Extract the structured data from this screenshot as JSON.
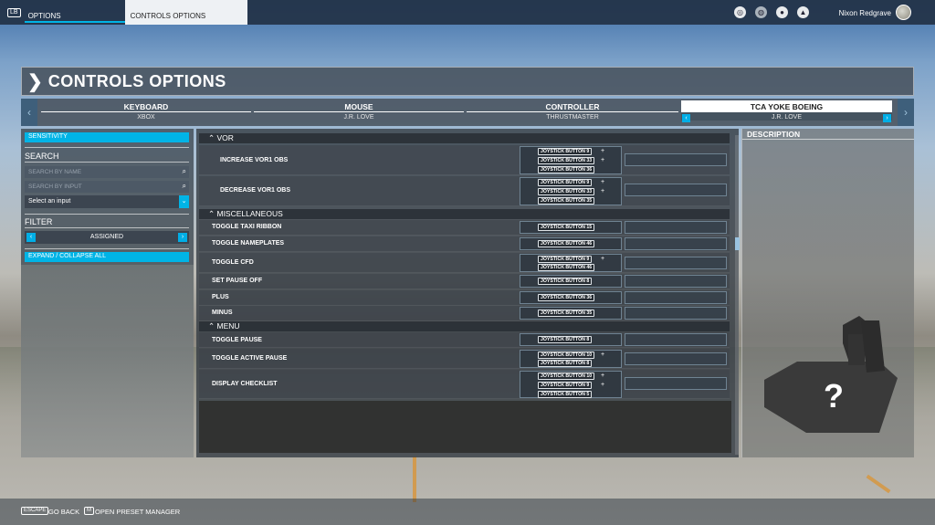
{
  "topbar": {
    "lb_key": "LB",
    "tab_options": "OPTIONS",
    "tab_controls_options": "CONTROLS OPTIONS",
    "username": "Nixon Redgrave"
  },
  "header": {
    "title": "CONTROLS OPTIONS"
  },
  "device_tabs": [
    {
      "name": "KEYBOARD",
      "profile": "XBOX"
    },
    {
      "name": "MOUSE",
      "profile": "J.R. LOVE"
    },
    {
      "name": "CONTROLLER",
      "profile": "THRUSTMASTER"
    },
    {
      "name": "TCA YOKE BOEING",
      "profile": "J.R. LOVE"
    }
  ],
  "sidebar": {
    "sensitivity": "SENSITIVITY",
    "search_label": "SEARCH",
    "search_by_name": "SEARCH BY NAME",
    "search_by_input": "SEARCH BY INPUT",
    "select_input": "Select an input",
    "filter_label": "FILTER",
    "filter_value": "ASSIGNED",
    "expand_collapse": "EXPAND / COLLAPSE ALL"
  },
  "list": {
    "categories": [
      "VOR",
      "MISCELLANEOUS",
      "MENU"
    ],
    "rows": [
      {
        "label": "INCREASE VOR1 OBS",
        "buttons": [
          "JOYSTICK BUTTON 9",
          "JOYSTICK BUTTON 33",
          "JOYSTICK BUTTON 36"
        ]
      },
      {
        "label": "DECREASE VOR1 OBS",
        "buttons": [
          "JOYSTICK BUTTON 9",
          "JOYSTICK BUTTON 33",
          "JOYSTICK BUTTON 35"
        ]
      },
      {
        "label": "TOGGLE TAXI RIBBON",
        "buttons": [
          "JOYSTICK BUTTON 15"
        ]
      },
      {
        "label": "TOGGLE NAMEPLATES",
        "buttons": [
          "JOYSTICK BUTTON 46"
        ]
      },
      {
        "label": "TOGGLE CFD",
        "buttons": [
          "JOYSTICK BUTTON 9",
          "JOYSTICK BUTTON 46"
        ]
      },
      {
        "label": "SET PAUSE OFF",
        "buttons": [
          "JOYSTICK BUTTON 8"
        ]
      },
      {
        "label": "PLUS",
        "buttons": [
          "JOYSTICK BUTTON 36"
        ]
      },
      {
        "label": "MINUS",
        "buttons": [
          "JOYSTICK BUTTON 35"
        ]
      },
      {
        "label": "TOGGLE PAUSE",
        "buttons": [
          "JOYSTICK BUTTON 8"
        ]
      },
      {
        "label": "TOGGLE ACTIVE PAUSE",
        "buttons": [
          "JOYSTICK BUTTON 10",
          "JOYSTICK BUTTON 8"
        ]
      },
      {
        "label": "DISPLAY CHECKLIST",
        "buttons": [
          "JOYSTICK BUTTON 10",
          "JOYSTICK BUTTON 9",
          "JOYSTICK BUTTON 5"
        ]
      }
    ]
  },
  "description": {
    "title": "DESCRIPTION",
    "placeholder": "?"
  },
  "bottombar": {
    "escape_key": "ESCAPE",
    "go_back": "GO BACK",
    "m_key": "M",
    "open_preset_manager": "OPEN PRESET MANAGER"
  },
  "colors": {
    "accent": "#00b4e6",
    "panel": "#3c4550"
  },
  "icons": [
    "flight-hub-icon",
    "community-icon",
    "profile-icon",
    "notifications-icon",
    "search-icon",
    "chevron-down-icon",
    "arrow-left-icon",
    "arrow-right-icon",
    "header-chevron-icon",
    "yoke-device-icon"
  ]
}
